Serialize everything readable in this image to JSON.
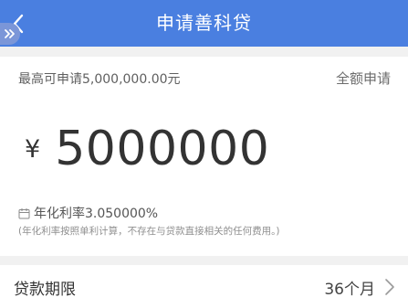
{
  "header": {
    "title": "申请善科贷"
  },
  "card": {
    "max_label": "最高可申请5,000,000.00元",
    "full_apply_label": "全额申请",
    "currency_symbol": "¥",
    "amount_value": "5000000",
    "rate_label": "年化利率3.050000%",
    "rate_note": "(年化利率按照单利计算，不存在与贷款直接相关的任何费用。)"
  },
  "term": {
    "label": "贷款期限",
    "value": "36个月"
  },
  "colors": {
    "header_bg": "#4a7fe0",
    "page_bg": "#f1f1f1"
  },
  "icons": [
    "back-arrow-icon",
    "double-chevron-icon",
    "calendar-icon",
    "chevron-right-icon"
  ]
}
